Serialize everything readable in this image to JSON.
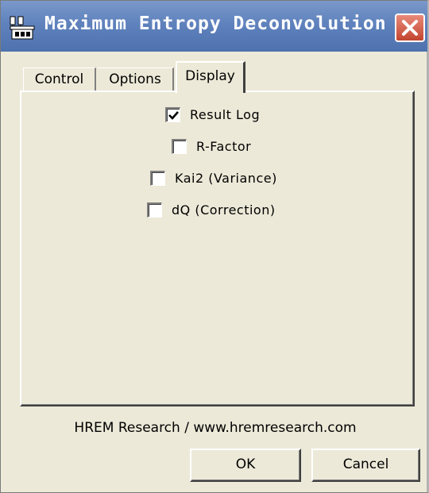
{
  "window": {
    "title": "Maximum Entropy Deconvolution",
    "app_icon": "network-icon",
    "close_icon": "close-icon"
  },
  "tabs": [
    {
      "label": "Control",
      "selected": false
    },
    {
      "label": "Options",
      "selected": false
    },
    {
      "label": "Display",
      "selected": true
    }
  ],
  "display_options": [
    {
      "label": "Result Log",
      "checked": true
    },
    {
      "label": "R-Factor",
      "checked": false
    },
    {
      "label": "Kai2 (Variance)",
      "checked": false
    },
    {
      "label": "dQ (Correction)",
      "checked": false
    }
  ],
  "footer": {
    "credit": "HREM Research / www.hremresearch.com"
  },
  "buttons": {
    "ok": "OK",
    "cancel": "Cancel"
  },
  "colors": {
    "titlebar": "#5f82bd",
    "close_button": "#c2452f",
    "window_bg": "#ece9d8"
  }
}
